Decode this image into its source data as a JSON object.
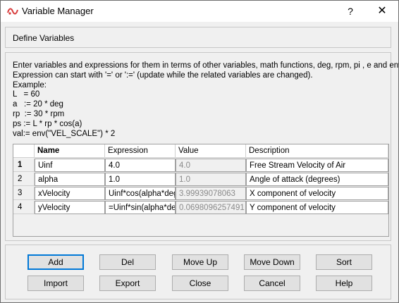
{
  "window": {
    "title": "Variable Manager",
    "help_glyph": "?",
    "close_glyph": "✕"
  },
  "section": {
    "header": "Define Variables"
  },
  "instructions": {
    "lines": [
      "Enter variables and expressions for them in terms of other variables, math functions, deg, rpm, pi , e and env.",
      "Expression can start with '=' or ':=' (update while the related variables are changed).",
      "Example:",
      "L   = 60",
      "a   := 20 * deg",
      "rp  := 30 * rpm",
      "ps := L * rp * cos(a)",
      "val:= env(\"VEL_SCALE\") * 2"
    ]
  },
  "table": {
    "headers": {
      "num": "",
      "name": "Name",
      "expression": "Expression",
      "value": "Value",
      "description": "Description"
    },
    "rows": [
      {
        "num": "1",
        "name": "Uinf",
        "expression": "4.0",
        "value": "4.0",
        "description": "Free Stream Velocity of Air"
      },
      {
        "num": "2",
        "name": "alpha",
        "expression": "1.0",
        "value": "1.0",
        "description": "Angle of attack (degrees)"
      },
      {
        "num": "3",
        "name": "xVelocity",
        "expression": "Uinf*cos(alpha*deg)",
        "value": "3.99939078063",
        "description": "X component of velocity"
      },
      {
        "num": "4",
        "name": "yVelocity",
        "expression": "=Uinf*sin(alpha*deg)",
        "value": "0.0698096257491",
        "description": "Y component of velocity"
      }
    ]
  },
  "buttons": {
    "add": "Add",
    "del": "Del",
    "move_up": "Move Up",
    "move_down": "Move Down",
    "sort": "Sort",
    "import": "Import",
    "export": "Export",
    "close": "Close",
    "cancel": "Cancel",
    "help": "Help"
  },
  "colors": {
    "accent": "#0078d7",
    "icon_red": "#d83b3b"
  },
  "icons": {
    "app": "variable-manager-app-icon",
    "help": "help-icon",
    "close": "close-icon"
  }
}
